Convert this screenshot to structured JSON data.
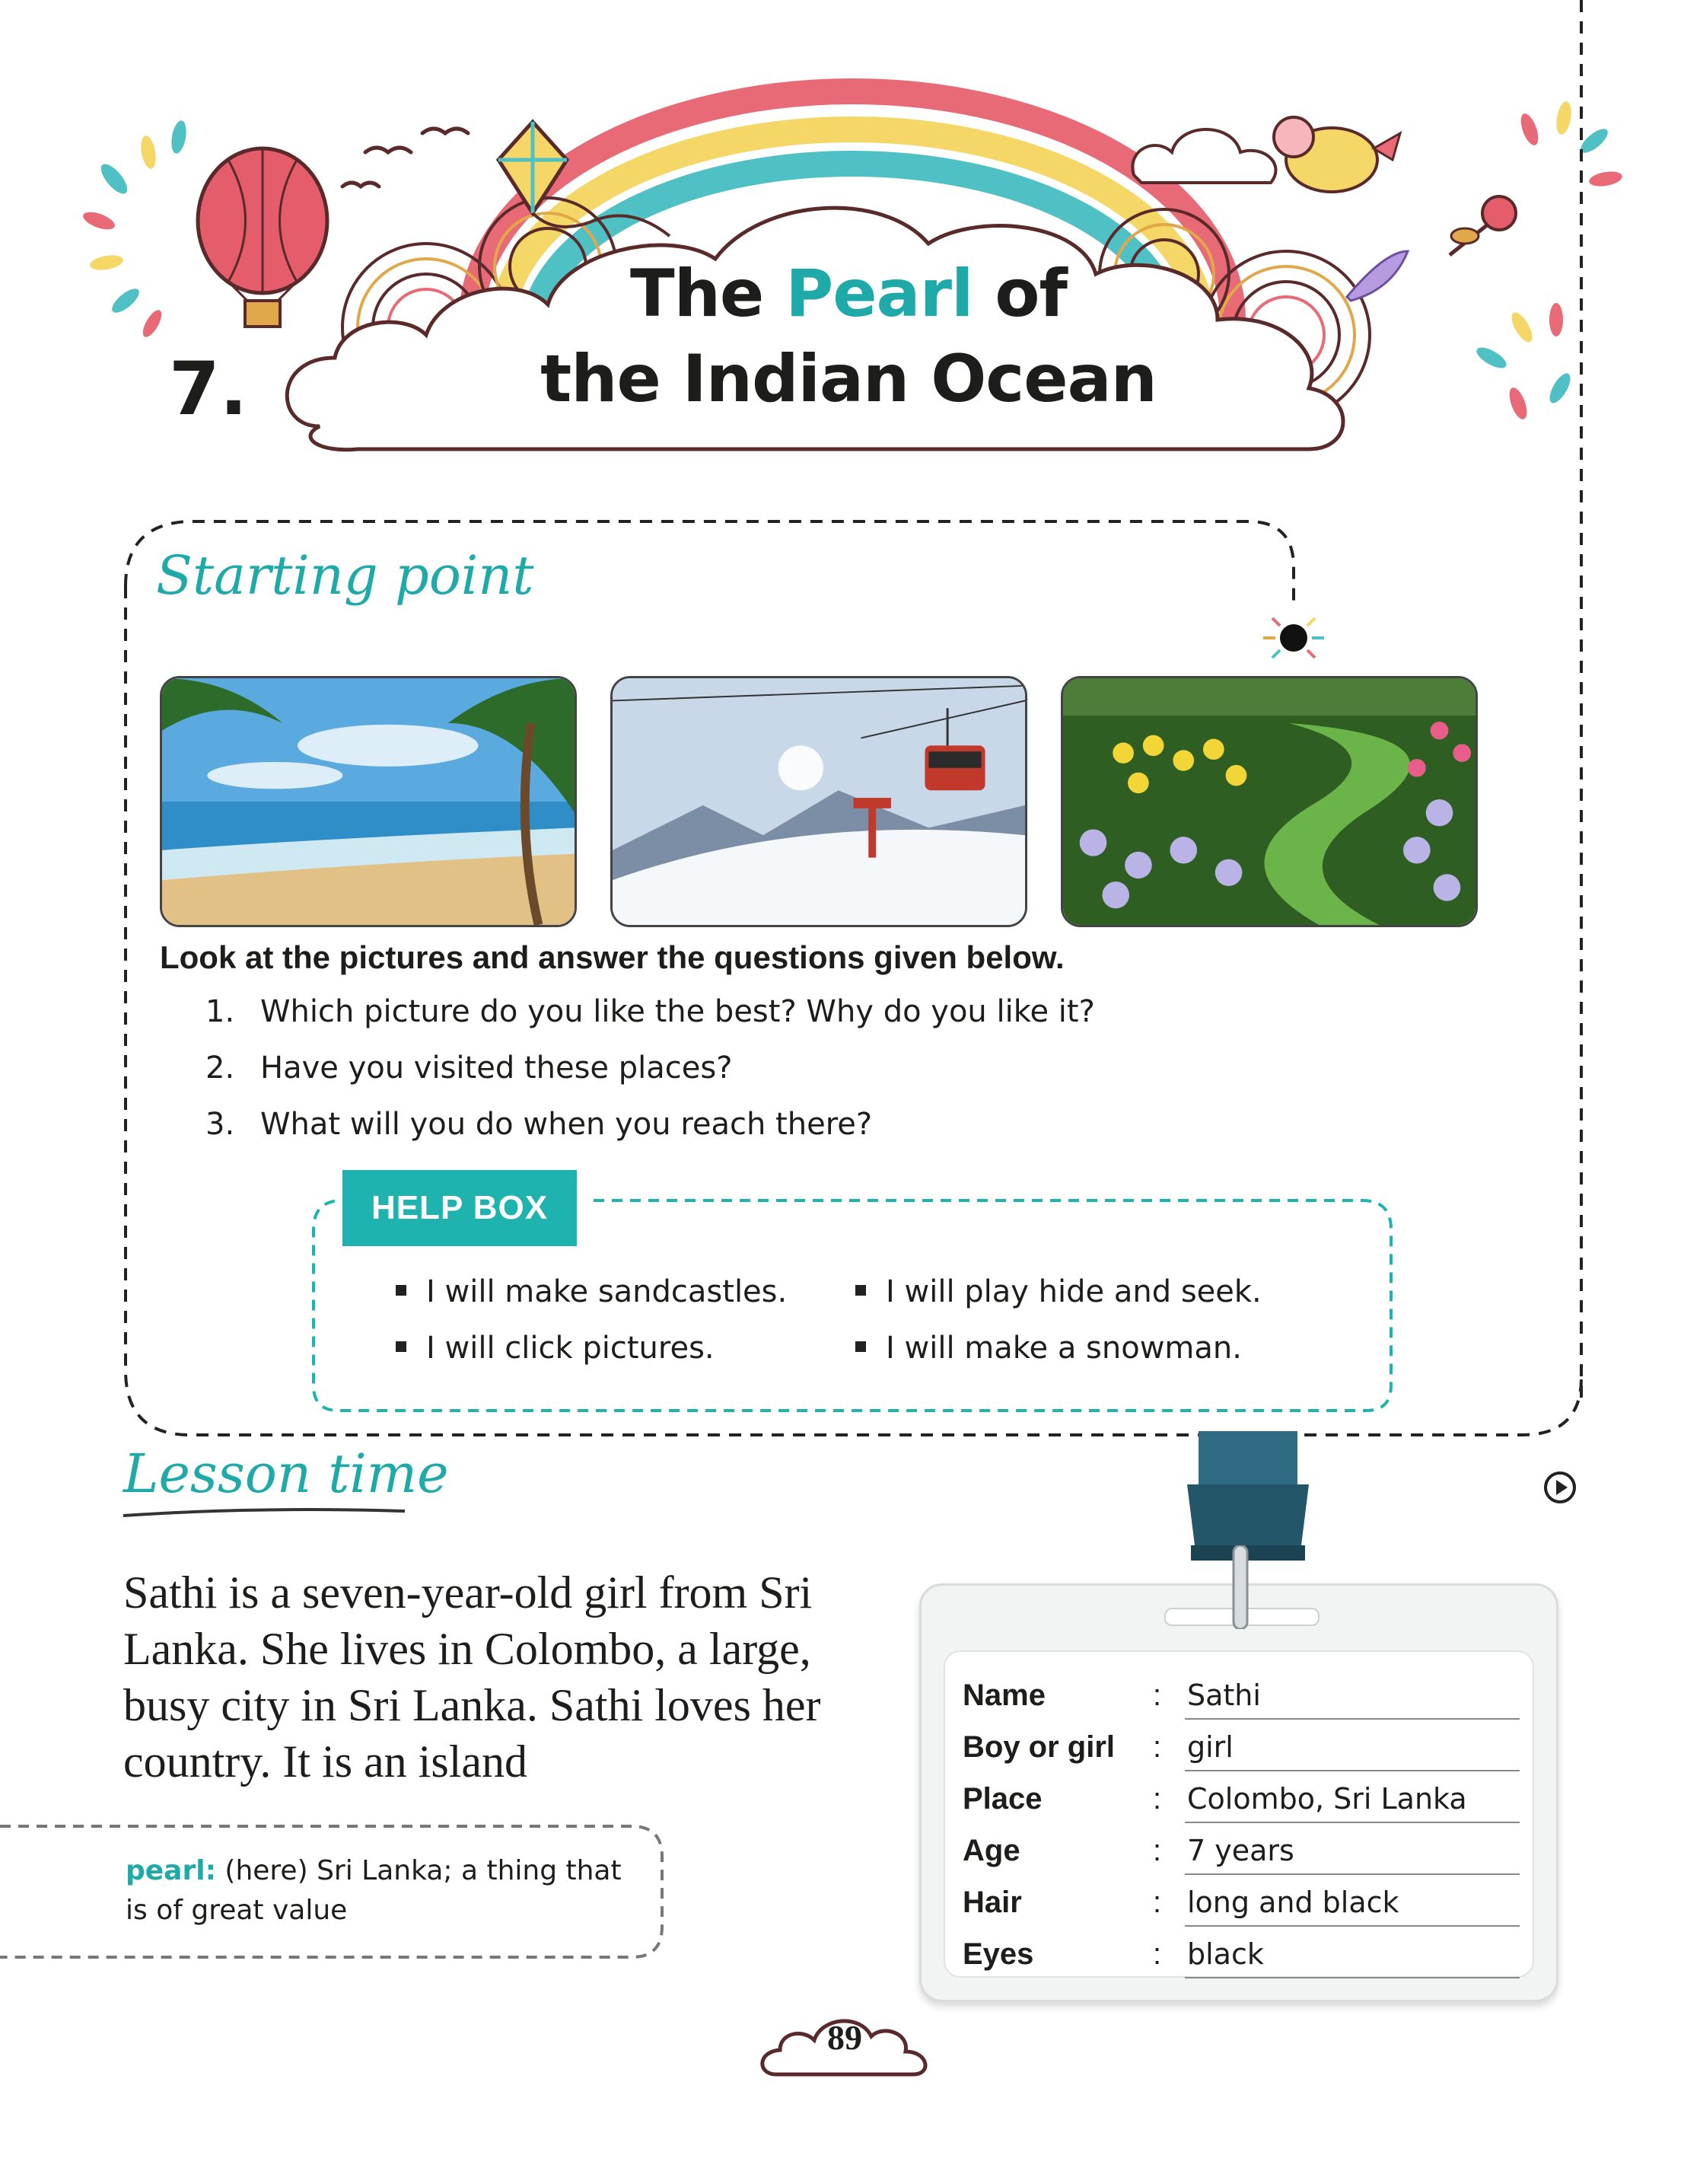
{
  "header": {
    "chapter_number": "7.",
    "title_part1": "The ",
    "title_accent": "Pearl",
    "title_part2": " of",
    "title_line2": "the Indian Ocean"
  },
  "starting_point": {
    "heading": "Starting point",
    "photos": [
      {
        "icon": "beach-photo"
      },
      {
        "icon": "snow-cable-car-photo"
      },
      {
        "icon": "flower-garden-photo"
      }
    ],
    "instruction": "Look at the pictures and answer the questions given below.",
    "questions": [
      {
        "num": "1.",
        "text": "Which picture do you like the best? Why do you like it?"
      },
      {
        "num": "2.",
        "text": "Have you visited these places?"
      },
      {
        "num": "3.",
        "text": "What will you do when you reach there?"
      }
    ],
    "help_box": {
      "label": "HELP BOX",
      "items": [
        "I will make sandcastles.",
        "I will click pictures.",
        "I will play hide and seek.",
        "I will make a snowman."
      ]
    }
  },
  "lesson": {
    "heading": "Lesson time",
    "paragraph": "Sathi is a seven-year-old girl from Sri Lanka. She lives in Colombo, a large, busy city in Sri Lanka. Sathi loves her country. It is an island",
    "glossary": {
      "term": "pearl:",
      "definition": " (here) Sri Lanka; a thing that is of great value"
    }
  },
  "id_card": {
    "separator": ":",
    "rows": [
      {
        "key": "Name",
        "value": "Sathi"
      },
      {
        "key": "Boy or girl",
        "value": "girl"
      },
      {
        "key": "Place",
        "value": "Colombo, Sri Lanka"
      },
      {
        "key": "Age",
        "value": "7 years"
      },
      {
        "key": "Hair",
        "value": "long and black"
      },
      {
        "key": "Eyes",
        "value": "black"
      }
    ]
  },
  "page_number": "89",
  "colors": {
    "accent": "#1fa9a9",
    "help_label_bg": "#1fb3b0",
    "lanyard": "#2d6a80"
  }
}
